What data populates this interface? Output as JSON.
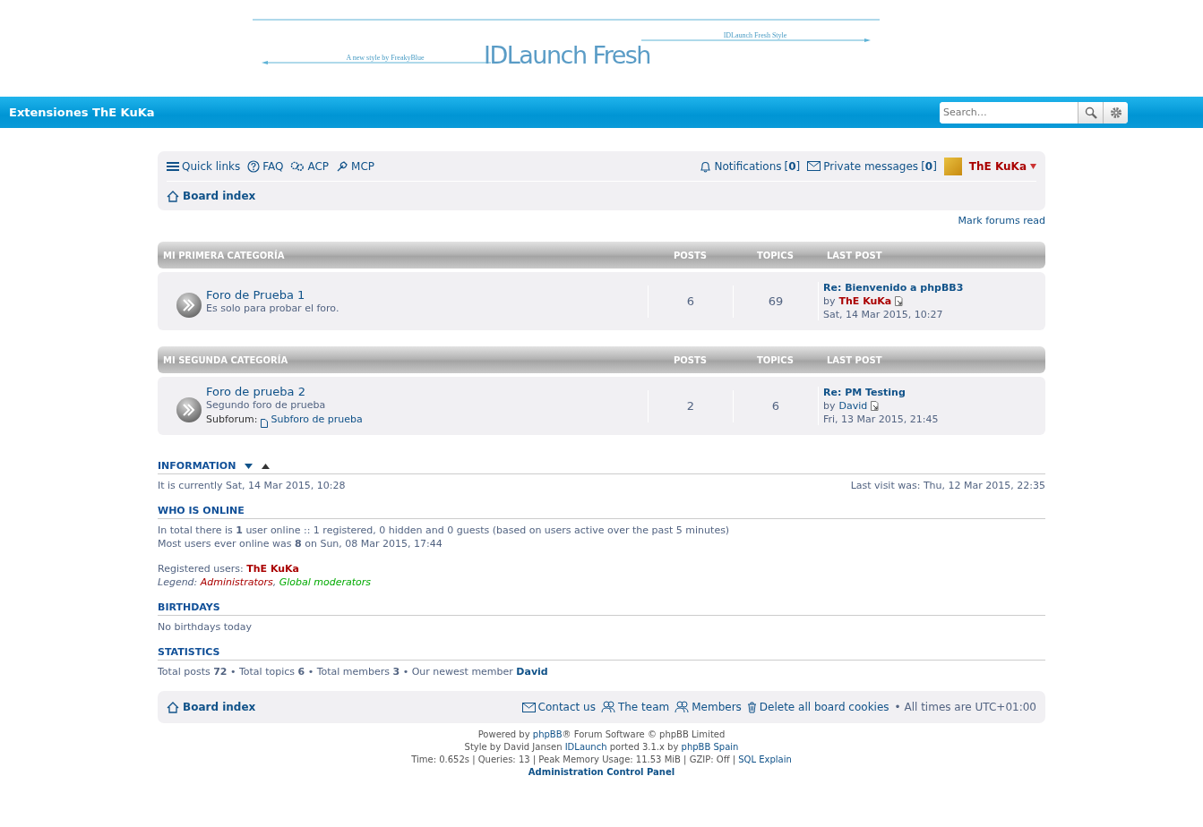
{
  "logo": {
    "title": "IDLaunch Fresh",
    "left_caption": "A new style by FreakyBlue",
    "right_caption": "IDLaunch Fresh Style"
  },
  "site_bar": {
    "site_name": "Extensiones ThE KuKa",
    "search": {
      "placeholder": "Search…"
    }
  },
  "navbar": {
    "links": [
      {
        "label": "Quick links"
      },
      {
        "label": "FAQ"
      },
      {
        "label": "ACP"
      },
      {
        "label": "MCP"
      }
    ],
    "notifications": {
      "label": "Notifications",
      "count": "[**0**]"
    },
    "private_messages": {
      "label": "Private messages",
      "count": "[**0**]"
    },
    "user": {
      "name": "ThE KuKa",
      "color": "#aa0000"
    },
    "breadcrumb": "Board index"
  },
  "mark_forums_read": "Mark forums read",
  "categories": [
    {
      "title": "MI PRIMERA CATEGORÍA",
      "columns": [
        "POSTS",
        "TOPICS",
        "LAST POST"
      ],
      "forums": [
        {
          "name": "Foro de Prueba 1",
          "description": "Es solo para probar el foro.",
          "posts": "6",
          "topics": "69",
          "last_post": {
            "title": "Re: Bienvenido a phpBB3",
            "by": "by",
            "author": "ThE KuKa",
            "color": "#aa0000",
            "date": "Sat, 14 Mar 2015, 10:27"
          }
        }
      ]
    },
    {
      "title": "MI SEGUNDA CATEGORÍA",
      "columns": [
        "POSTS",
        "TOPICS",
        "LAST POST"
      ],
      "forums": [
        {
          "name": "Foro de prueba 2",
          "description": "Segundo foro de prueba",
          "subforum_label": "Subforum:",
          "subforum": "Subforo de prueba",
          "posts": "2",
          "topics": "6",
          "last_post": {
            "title": "Re: PM Testing",
            "by": "by",
            "author": "David",
            "color": "#105289",
            "date": "Fri, 13 Mar 2015, 21:45"
          }
        }
      ]
    }
  ],
  "information": {
    "heading": "INFORMATION",
    "current_time": "It is currently Sat, 14 Mar 2015, 10:28",
    "last_visit": "Last visit was: Thu, 12 Mar 2015, 22:35"
  },
  "who_is_online": {
    "heading": "WHO IS ONLINE",
    "lines": [
      "In total there is **1** user online :: 1 registered, 0 hidden and 0 guests (based on users active over the past 5 minutes)",
      "Most users ever online was **8** on Sun, 08 Mar 2015, 17:44"
    ],
    "registered_label": "Registered users:",
    "registered_users": [
      {
        "name": "ThE KuKa",
        "color": "#aa0000"
      }
    ],
    "legend_label": "Legend:",
    "legend_separator": ",",
    "legend": [
      {
        "name": "Administrators",
        "color": "#aa0000"
      },
      {
        "name": "Global moderators",
        "color": "#00aa00"
      }
    ]
  },
  "birthdays": {
    "heading": "BIRTHDAYS",
    "text": "No birthdays today"
  },
  "statistics": {
    "heading": "STATISTICS",
    "text": "Total posts **72** • Total topics **6** • Total members **3** • Our newest member",
    "newest_member": "David"
  },
  "footer_nav": {
    "breadcrumb": "Board index",
    "links": [
      {
        "label": "Contact us"
      },
      {
        "label": "The team"
      },
      {
        "label": "Members"
      },
      {
        "label": "Delete all board cookies"
      }
    ],
    "timezone": "• All times are UTC+01:00"
  },
  "credits": [
    [
      {
        "kind": "text",
        "text": "Powered by "
      },
      {
        "kind": "link",
        "text": "phpBB"
      },
      {
        "kind": "text",
        "text": "® Forum Software © phpBB Limited"
      }
    ],
    [
      {
        "kind": "text",
        "text": "Style by David Jansen "
      },
      {
        "kind": "link",
        "text": "IDLaunch"
      },
      {
        "kind": "text",
        "text": " ported 3.1.x by "
      },
      {
        "kind": "link",
        "text": "phpBB Spain"
      }
    ],
    [
      {
        "kind": "text",
        "text": "Time: 0.652s | Queries: 13 | Peak Memory Usage: 11.53 MiB | GZIP: Off | "
      },
      {
        "kind": "link",
        "text": "SQL Explain"
      }
    ],
    [
      {
        "kind": "strong_link",
        "text": "Administration Control Panel"
      }
    ]
  ]
}
